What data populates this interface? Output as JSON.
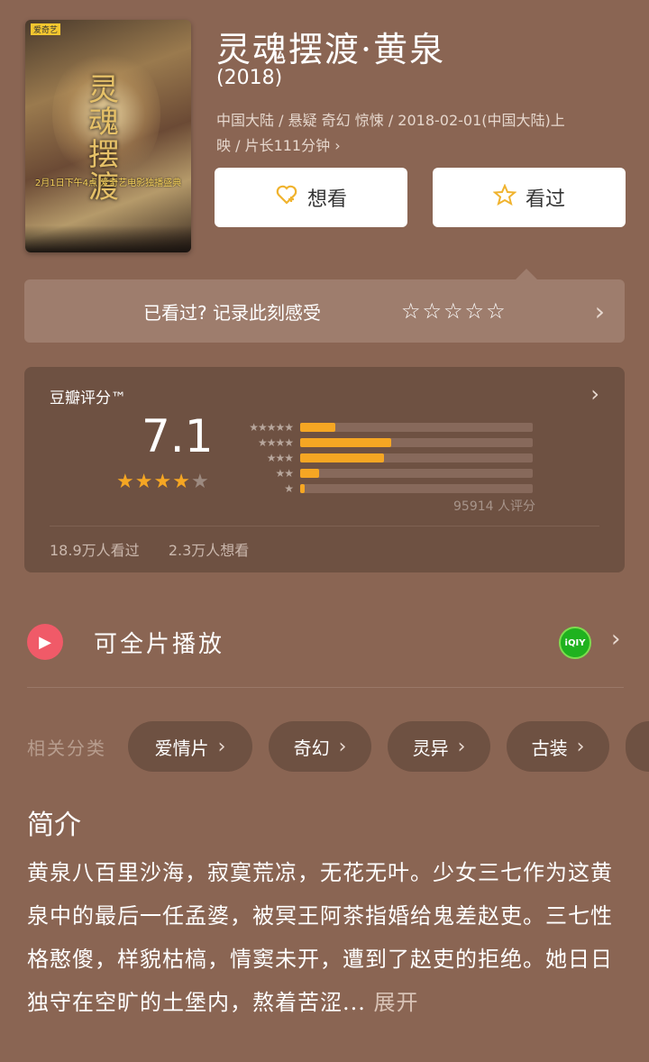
{
  "movie": {
    "title": "灵魂摆渡·黄泉",
    "year": "(2018)",
    "meta_line1": "中国大陆 / 悬疑 奇幻 惊悚 / 2018-02-01(中国大陆)上",
    "meta_line2": "映 / 片长111分钟 ›",
    "poster": {
      "title_text": "灵魂摆渡",
      "date_text": "2月1日下午4点 爱奇艺电影独播盛典",
      "logo": "爱奇艺"
    }
  },
  "actions": {
    "want_label": "想看",
    "seen_label": "看过",
    "want_icon": "heart-plus-icon",
    "seen_icon": "star-icon"
  },
  "rate_prompt": {
    "text": "已看过? 记录此刻感受",
    "stars": "☆☆☆☆☆",
    "chevron": "›"
  },
  "score": {
    "label": "豆瓣评分™",
    "value": "7.1",
    "stars_display": {
      "full": 3,
      "half": 1,
      "empty": 1
    },
    "distribution": [
      {
        "stars": "★★★★★",
        "fraction": 0.15
      },
      {
        "stars": "★★★★",
        "fraction": 0.39
      },
      {
        "stars": "★★★",
        "fraction": 0.36
      },
      {
        "stars": "★★",
        "fraction": 0.08
      },
      {
        "stars": "★",
        "fraction": 0.02
      }
    ],
    "count_text": "95914 人评分",
    "seen_text": "18.9万人看过",
    "want_text": "2.3万人想看"
  },
  "play": {
    "label": "可全片播放",
    "provider": "iQIY",
    "provider_color": "#1fb21f"
  },
  "categories": {
    "label": "相关分类",
    "items": [
      "爱情片",
      "奇幻",
      "灵异",
      "古装"
    ]
  },
  "intro": {
    "heading": "简介",
    "body": "黄泉八百里沙海，寂寞荒凉，无花无叶。少女三七作为这黄泉中的最后一任孟婆，被冥王阿茶指婚给鬼差赵吏。三七性格憨傻，样貌枯槁，情窦未开，遭到了赵吏的拒绝。她日日独守在空旷的土堡内，熬着苦涩...",
    "more": " 展开"
  },
  "colors": {
    "background": "#8a6553",
    "card": "#6e5142",
    "accent_star": "#f5a623",
    "play_red": "#f05a68"
  }
}
